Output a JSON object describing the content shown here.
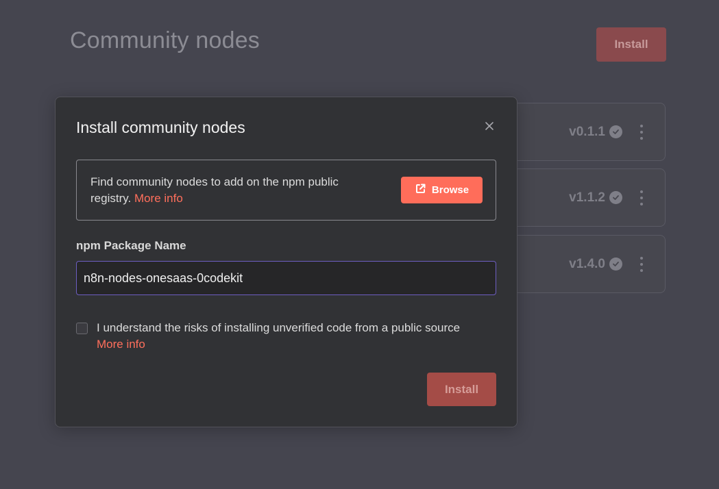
{
  "page": {
    "title": "Community nodes",
    "install_label": "Install"
  },
  "nodes": [
    {
      "version": "v0.1.1",
      "status_icon": "verified-check-icon",
      "menu_icon": "more-vertical-icon"
    },
    {
      "version": "v1.1.2",
      "status_icon": "verified-check-icon",
      "menu_icon": "more-vertical-icon"
    },
    {
      "version": "v1.4.0",
      "status_icon": "verified-check-icon",
      "menu_icon": "more-vertical-icon"
    }
  ],
  "modal": {
    "title": "Install community nodes",
    "info_text": "Find community nodes to add on the npm public registry.",
    "info_link": "More info",
    "browse_label": "Browse",
    "package_label": "npm Package Name",
    "package_value": "n8n-nodes-onesaas-0codekit",
    "consent_text": "I understand the risks of installing unverified code from a public source",
    "consent_link": "More info",
    "install_label": "Install"
  },
  "colors": {
    "accent": "#ff6d5a",
    "input_focus_border": "#6d5ec2"
  }
}
